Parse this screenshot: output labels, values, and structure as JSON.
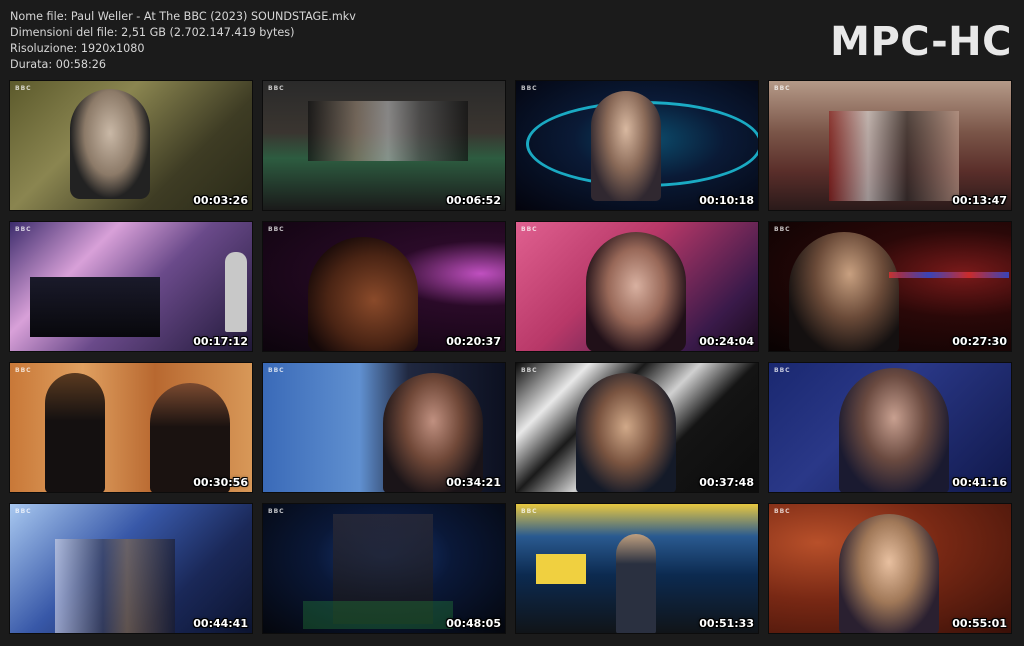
{
  "file_info": {
    "name": "Nome file: Paul Weller - At The BBC (2023) SOUNDSTAGE.mkv",
    "size": "Dimensioni del file: 2,51 GB (2.702.147.419 bytes)",
    "resolution": "Risoluzione: 1920x1080",
    "duration": "Durata: 00:58:26"
  },
  "logo": "MPC-HC",
  "thumbnails": [
    {
      "bbc": "BBC",
      "time": "00:03:26"
    },
    {
      "bbc": "BBC",
      "time": "00:06:52"
    },
    {
      "bbc": "BBC",
      "time": "00:10:18"
    },
    {
      "bbc": "BBC",
      "time": "00:13:47"
    },
    {
      "bbc": "BBC",
      "time": "00:17:12"
    },
    {
      "bbc": "BBC",
      "time": "00:20:37"
    },
    {
      "bbc": "BBC",
      "time": "00:24:04"
    },
    {
      "bbc": "BBC",
      "time": "00:27:30"
    },
    {
      "bbc": "BBC",
      "time": "00:30:56"
    },
    {
      "bbc": "BBC",
      "time": "00:34:21"
    },
    {
      "bbc": "BBC",
      "time": "00:37:48"
    },
    {
      "bbc": "BBC",
      "time": "00:41:16"
    },
    {
      "bbc": "BBC",
      "time": "00:44:41"
    },
    {
      "bbc": "BBC",
      "time": "00:48:05"
    },
    {
      "bbc": "BBC",
      "time": "00:51:33"
    },
    {
      "bbc": "BBC",
      "time": "00:55:01"
    }
  ]
}
